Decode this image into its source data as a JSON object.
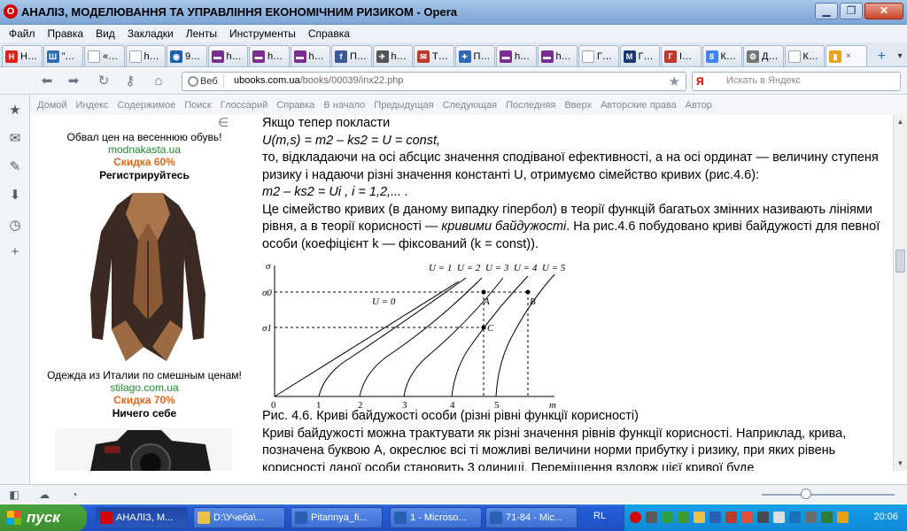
{
  "window": {
    "title": "АНАЛІЗ, МОДЕЛЮВАННЯ ТА УПРАВЛІННЯ ЕКОНОМІЧНИМ РИЗИКОМ - Opera",
    "controls": [
      "minimize",
      "maximize",
      "close"
    ]
  },
  "menu": [
    "Файл",
    "Правка",
    "Вид",
    "Закладки",
    "Ленты",
    "Инструменты",
    "Справка"
  ],
  "tabs": [
    {
      "label": "Н…",
      "color": "#d9261c",
      "glyph": "Н"
    },
    {
      "label": "\"…",
      "color": "#2f6bb5",
      "glyph": "Ш"
    },
    {
      "label": "«…",
      "color": "#ffffff",
      "glyph": ""
    },
    {
      "label": "h…",
      "color": "#ffffff",
      "glyph": ""
    },
    {
      "label": "9…",
      "color": "#1b5fae",
      "glyph": "◉"
    },
    {
      "label": "h…",
      "color": "#7a2e8e",
      "glyph": "▬"
    },
    {
      "label": "h…",
      "color": "#7a2e8e",
      "glyph": "▬"
    },
    {
      "label": "h…",
      "color": "#7a2e8e",
      "glyph": "▬"
    },
    {
      "label": "П…",
      "color": "#3b5998",
      "glyph": "f"
    },
    {
      "label": "h…",
      "color": "#555555",
      "glyph": "✈"
    },
    {
      "label": "Т…",
      "color": "#c0392b",
      "glyph": "✉"
    },
    {
      "label": "П…",
      "color": "#2f6bb5",
      "glyph": "✦"
    },
    {
      "label": "h…",
      "color": "#7a2e8e",
      "glyph": "▬"
    },
    {
      "label": "h…",
      "color": "#7a2e8e",
      "glyph": "▬"
    },
    {
      "label": "Г…",
      "color": "#ffffff",
      "glyph": ""
    },
    {
      "label": "Г…",
      "color": "#1b3b6f",
      "glyph": "M"
    },
    {
      "label": "I…",
      "color": "#c0392b",
      "glyph": "Г"
    },
    {
      "label": "К…",
      "color": "#4285f4",
      "glyph": "8"
    },
    {
      "label": "Д…",
      "color": "#777777",
      "glyph": "⚙"
    },
    {
      "label": "К…",
      "color": "#ffffff",
      "glyph": ""
    },
    {
      "label": "",
      "color": "#e8a21a",
      "glyph": "▮",
      "active": true
    }
  ],
  "tab_close": "×",
  "new_tab": "+",
  "nav": {
    "badge": "Веб",
    "url_host": "ubooks.com.ua",
    "url_path": "/books/00039/inx22.php",
    "search_engine": "Я",
    "search_placeholder": "Искать в Яндекс"
  },
  "site_nav": [
    "Домой",
    "Индекс",
    "Содержимое",
    "Поиск",
    "Глоссарий",
    "Справка",
    "В начало",
    "Предыдущая",
    "Следующая",
    "Последняя",
    "Вверх",
    "Авторские права",
    "Автор"
  ],
  "ads": [
    {
      "title": "Обвал цен на весеннюю обувь!",
      "link": "modnakasta.ua",
      "sale": "Скидка 60%"
    },
    {
      "title": "Одежда из Италии по смешным ценам!",
      "link": "stilago.com.ua",
      "sale": "Скидка 70%"
    }
  ],
  "ad_headings": [
    "Регистрируйтесь",
    "Ничего себе"
  ],
  "article": {
    "cut_symbol": "∈",
    "p1": "Якщо тепер покласти",
    "formula1": "U(m,s) = m2 – ks2 = U = const,",
    "p2": "то, відкладаючи на осі абсцис значення сподіваної ефективності, а на осі ординат — величину ступеня ризику і надаючи різні значення константі U, отримуємо сімейство кривих (рис.4.6):",
    "formula2": "m2 – ks2 = Ui , i = 1,2,...  .",
    "p3a": "Це сімейство кривих (в даному випадку гіпербол) в теорії функцій багатьох змінних називають лініями рівня, а в теорії корисності — ",
    "p3b": "кривими байдужості",
    "p3c": ". На рис.4.6 побудовано криві байдужості для певної особи (коефіцієнт k — фіксований (k = const)).",
    "caption": "Рис. 4.6. Криві байдужості особи (різні рівні функції корисності)",
    "p4": "Криві байдужості можна трактувати як різні значення рівнів функції корисності. Наприклад, крива, позначена буквою А, окреслює всі ті можливі величини норми прибутку і ризику, при яких рівень корисності даної особи становить 3 одиниці. Переміщення вздовж цієї кривої буде"
  },
  "figure": {
    "y_axis": "σ",
    "x_axis": "m",
    "y_ticks": [
      "σ0",
      "σ1"
    ],
    "x_ticks": [
      "0",
      "1",
      "2",
      "3",
      "4",
      "5"
    ],
    "curve_labels": [
      "U = 1",
      "U = 2",
      "U = 3",
      "U = 4",
      "U = 5"
    ],
    "u0_label": "U = 0",
    "points": [
      "A",
      "B",
      "C"
    ]
  },
  "taskbar": {
    "start": "пуск",
    "buttons": [
      {
        "label": "АНАЛІЗ, М...",
        "color": "#d40000",
        "active": true
      },
      {
        "label": "D:\\Учеба\\...",
        "color": "#e8c14a"
      },
      {
        "label": "Pitannya_fi...",
        "color": "#2b5fb4"
      },
      {
        "label": "1 - Microso...",
        "color": "#2b5fb4"
      },
      {
        "label": "71-84 - Mic...",
        "color": "#2b5fb4"
      }
    ],
    "lang": "RL",
    "clock": "20:06"
  }
}
